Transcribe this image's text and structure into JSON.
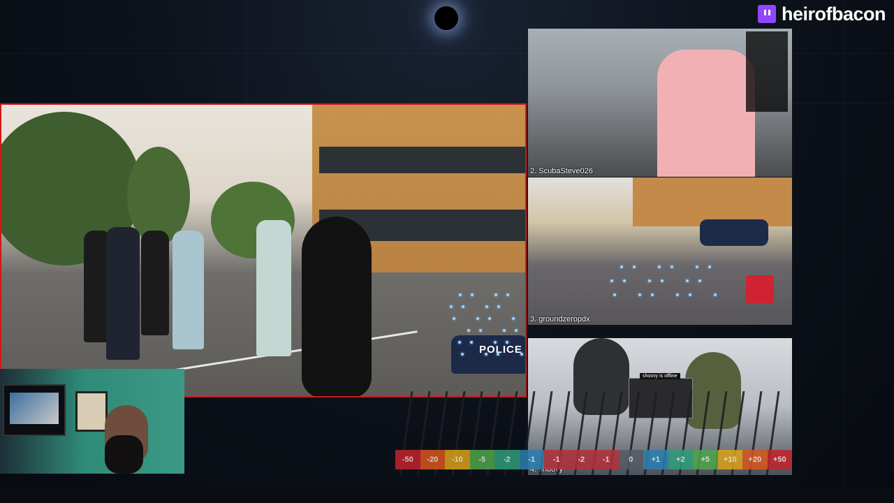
{
  "overlay": {
    "channel_name": "heirofbacon",
    "twitch_icon": "twitch-icon"
  },
  "feeds": {
    "main": {
      "label": ""
    },
    "tile1": {
      "label": "2. ScubaSteve026"
    },
    "tile2": {
      "label": "3. groundzeropdx"
    },
    "tile3": {
      "label": "4. shoovy",
      "pip_text": "shoovy is offline"
    }
  },
  "main_scene": {
    "police_text": "POLICE"
  },
  "scale": {
    "cells": [
      {
        "label": "-50",
        "color": "#c0232a"
      },
      {
        "label": "-20",
        "color": "#d9561f"
      },
      {
        "label": "-10",
        "color": "#dba119"
      },
      {
        "label": "-5",
        "color": "#4ea64b"
      },
      {
        "label": "-2",
        "color": "#2f9e79"
      },
      {
        "label": "-1",
        "color": "#2b7fb0"
      },
      {
        "label": "-1",
        "color": "#b3303b"
      },
      {
        "label": "-2",
        "color": "#b3303b"
      },
      {
        "label": "-1",
        "color": "#b3303b"
      },
      {
        "label": "0",
        "color": "#555a63"
      },
      {
        "label": "+1",
        "color": "#2b7fb0"
      },
      {
        "label": "+2",
        "color": "#2f9e79"
      },
      {
        "label": "+5",
        "color": "#4ea64b"
      },
      {
        "label": "+10",
        "color": "#dba119"
      },
      {
        "label": "+20",
        "color": "#d9561f"
      },
      {
        "label": "+50",
        "color": "#c0232a"
      }
    ]
  },
  "colors": {
    "active_border": "#d01818",
    "brand": "#9146ff"
  }
}
